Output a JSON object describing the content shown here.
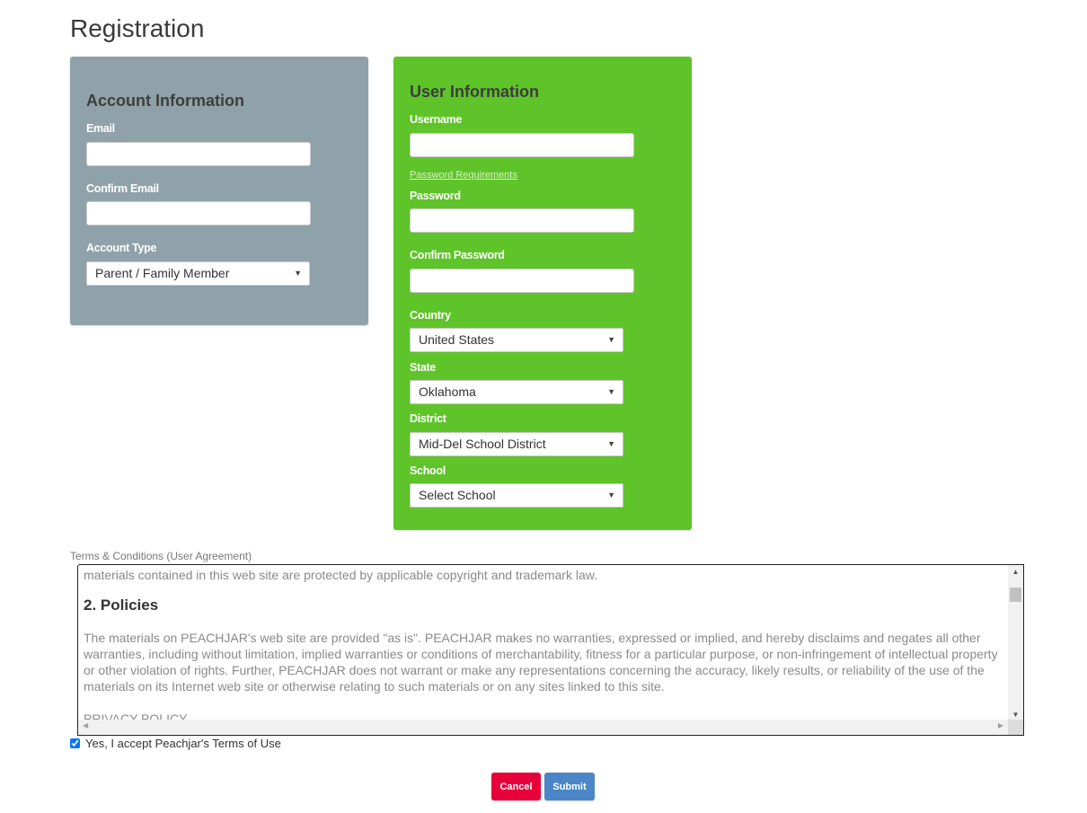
{
  "page": {
    "title": "Registration"
  },
  "account_panel": {
    "heading": "Account Information",
    "email_label": "Email",
    "email_value": "",
    "confirm_email_label": "Confirm Email",
    "confirm_email_value": "",
    "account_type_label": "Account Type",
    "account_type_value": "Parent / Family Member",
    "background_color": "#8fa2aa"
  },
  "user_panel": {
    "heading": "User Information",
    "username_label": "Username",
    "username_value": "",
    "password_requirements_link": "Password Requirements",
    "password_label": "Password",
    "password_value": "",
    "confirm_password_label": "Confirm Password",
    "confirm_password_value": "",
    "country_label": "Country",
    "country_value": "United States",
    "state_label": "State",
    "state_value": "Oklahoma",
    "district_label": "District",
    "district_value": "Mid-Del School District",
    "school_label": "School",
    "school_value": "Select School",
    "background_color": "#5fc32a"
  },
  "terms": {
    "label": "Terms & Conditions (User Agreement)",
    "partial_top_line": "materials contained in this web site are protected by applicable copyright and trademark law.",
    "section_heading": "2. Policies",
    "section_body": "The materials on PEACHJAR's web site are provided \"as is\". PEACHJAR makes no warranties, expressed or implied, and hereby disclaims and negates all other warranties, including without limitation, implied warranties or conditions of merchantability, fitness for a particular purpose, or non-infringement of intellectual property or other violation of rights. Further, PEACHJAR does not warrant or make any representations concerning the accuracy, likely results, or reliability of the use of the materials on its Internet web site or otherwise relating to such materials or on any sites linked to this site.",
    "next_heading_partial": "PRIVACY POLICY"
  },
  "accept": {
    "label": "Yes, I accept Peachjar's Terms of Use",
    "checked": true
  },
  "buttons": {
    "cancel": "Cancel",
    "submit": "Submit",
    "cancel_color": "#e8003a",
    "submit_color": "#4a86c8"
  },
  "icons": {
    "select_caret": "▼",
    "scroll_up": "▲",
    "scroll_down": "▼",
    "scroll_left": "◀",
    "scroll_right": "▶"
  }
}
